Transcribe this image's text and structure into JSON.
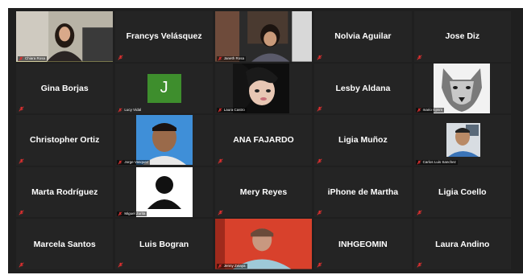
{
  "participants": [
    {
      "name": "Chiara Rosa",
      "kind": "video"
    },
    {
      "name": "Francys Velásquez",
      "kind": "text"
    },
    {
      "name": "Janeth Rosa",
      "kind": "video"
    },
    {
      "name": "Nolvia Aguilar",
      "kind": "text"
    },
    {
      "name": "Jose Diz",
      "kind": "text"
    },
    {
      "name": "Gina Borjas",
      "kind": "text"
    },
    {
      "name": "Lucy Vidal",
      "kind": "avatar",
      "initial": "J",
      "color": "#3e8e2d"
    },
    {
      "name": "Laura Castro",
      "kind": "photo"
    },
    {
      "name": "Lesby Aldana",
      "kind": "text"
    },
    {
      "name": "mario Gjmm",
      "kind": "photo"
    },
    {
      "name": "Christopher Ortiz",
      "kind": "text"
    },
    {
      "name": "Jorge Vasquez",
      "kind": "photo"
    },
    {
      "name": "ANA FAJARDO",
      "kind": "text"
    },
    {
      "name": "Ligia Muñoz",
      "kind": "text"
    },
    {
      "name": "Carlos Luis Sanchez",
      "kind": "photo"
    },
    {
      "name": "Marta Rodríguez",
      "kind": "text"
    },
    {
      "name": "Miguel Zurita",
      "kind": "photo"
    },
    {
      "name": "Mery Reyes",
      "kind": "text"
    },
    {
      "name": "iPhone de Martha",
      "kind": "text"
    },
    {
      "name": "Ligia Coello",
      "kind": "text"
    },
    {
      "name": "Marcela Santos",
      "kind": "text"
    },
    {
      "name": "Luis Bogran",
      "kind": "text"
    },
    {
      "name": "Jenny Zelaya",
      "kind": "video"
    },
    {
      "name": "INHGEOMIN",
      "kind": "text"
    },
    {
      "name": "Laura Andino",
      "kind": "text"
    }
  ],
  "colors": {
    "tile_bg": "#242424",
    "frame_bg": "#1f1f1f",
    "active_border": "#d8d85a",
    "mic_muted": "#e03030"
  },
  "icons": {
    "mic": "mic-muted-icon"
  }
}
